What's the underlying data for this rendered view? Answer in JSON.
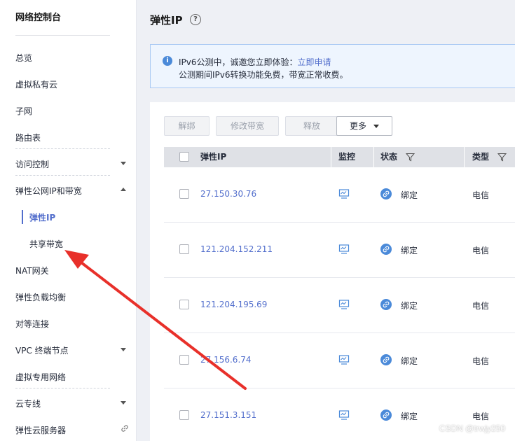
{
  "sidebar": {
    "title": "网络控制台",
    "items": [
      {
        "label": "总览"
      },
      {
        "label": "虚拟私有云"
      },
      {
        "label": "子网"
      },
      {
        "label": "路由表"
      },
      {
        "label": "访问控制"
      },
      {
        "label": "弹性公网IP和带宽"
      },
      {
        "label": "NAT网关"
      },
      {
        "label": "弹性负载均衡"
      },
      {
        "label": "对等连接"
      },
      {
        "label": "VPC 终端节点"
      },
      {
        "label": "虚拟专用网络"
      },
      {
        "label": "云专线"
      },
      {
        "label": "弹性云服务器"
      }
    ],
    "sub_items": [
      {
        "label": "弹性IP",
        "active": true
      },
      {
        "label": "共享带宽",
        "active": false
      }
    ]
  },
  "header": {
    "title": "弹性IP",
    "help_icon": "?"
  },
  "notice": {
    "icon": "i",
    "line1": "IPv6公测中，诚邀您立即体验：",
    "link": "立即申请",
    "line2": "公测期间IPv6转换功能免费，带宽正常收费。"
  },
  "toolbar": {
    "unbind": "解绑",
    "modify_bandwidth": "修改带宽",
    "release": "释放",
    "more": "更多"
  },
  "table": {
    "columns": {
      "ip": "弹性IP",
      "monitor": "监控",
      "status": "状态",
      "type": "类型"
    },
    "rows": [
      {
        "ip": "27.150.30.76",
        "status": "绑定",
        "type": "电信"
      },
      {
        "ip": "121.204.152.211",
        "status": "绑定",
        "type": "电信"
      },
      {
        "ip": "121.204.195.69",
        "status": "绑定",
        "type": "电信"
      },
      {
        "ip": "27.156.6.74",
        "status": "绑定",
        "type": "电信"
      },
      {
        "ip": "27.151.3.151",
        "status": "绑定",
        "type": "电信"
      }
    ]
  },
  "colors": {
    "accent": "#526ecc",
    "arrow": "#e8302a",
    "status_icon": "#4b8ad9"
  },
  "icons": [
    "help-icon",
    "info-icon",
    "chevron-down-icon",
    "chevron-up-icon",
    "filter-icon",
    "monitor-icon",
    "bind-status-icon",
    "link-icon"
  ],
  "watermark": "CSDN @trwjy250"
}
